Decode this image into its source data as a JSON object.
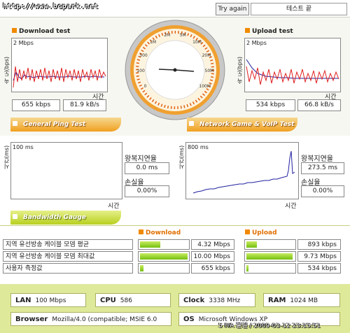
{
  "header": {
    "url": "http://www.bcpark.net",
    "retry_label": "Try again",
    "status_text": "테스트 끝"
  },
  "download": {
    "title": "Download test",
    "ylabel": "속 도(bps)",
    "scale": "2 Mbps",
    "xlabel": "시간",
    "kbps": "655 kbps",
    "kBs": "81.9 kB/s"
  },
  "upload": {
    "title": "Upload test",
    "ylabel": "속 도(bps)",
    "scale": "2 Mbps",
    "xlabel": "시간",
    "kbps": "534 kbps",
    "kBs": "66.8 kB/s"
  },
  "gauge": {
    "labels": [
      "0",
      "100",
      "500",
      "1M",
      "2M",
      "5M",
      "10M",
      "20M",
      "50M",
      "100M"
    ]
  },
  "ping": {
    "title": "General Ping Test",
    "ylabel": "시간(ms)",
    "scale": "100 ms",
    "xlabel": "시간",
    "rtt_label": "왕복지연율",
    "rtt_value": "0.0 ms",
    "loss_label": "손실율",
    "loss_value": "0.00%"
  },
  "game": {
    "title": "Network Game & VoIP Test",
    "ylabel": "시간(ms)",
    "scale": "800 ms",
    "xlabel": "시간",
    "rtt_label": "왕복지연율",
    "rtt_value": "273.5 ms",
    "loss_label": "손실율",
    "loss_value": "0.00%"
  },
  "bandwidth": {
    "title": "Bandwidth Gauge",
    "download_header": "Download",
    "upload_header": "Upload",
    "rows": [
      {
        "label": "지역 유선방송 케이블 모뎀 평균",
        "down": "4.32 Mbps",
        "down_fill": 0.43,
        "up": "893 kbps",
        "up_fill": 0.22
      },
      {
        "label": "지역 유선방송 케이블 모뎀 최대값",
        "down": "10.00 Mbps",
        "down_fill": 1.0,
        "up": "9.73 Mbps",
        "up_fill": 0.97
      },
      {
        "label": "사용자 측정값",
        "down": "655 kbps",
        "down_fill": 0.07,
        "up": "534 kbps",
        "up_fill": 0.05
      }
    ]
  },
  "system": {
    "lan_label": "LAN",
    "lan_value": "100 Mbps",
    "cpu_label": "CPU",
    "cpu_value": "586",
    "clock_label": "Clock",
    "clock_value": "3338 MHz",
    "ram_label": "RAM",
    "ram_value": "1024 MB",
    "browser_label": "Browser",
    "browser_value": "Mozilla/4.0 (compatible; MSIE 6.0",
    "os_label": "OS",
    "os_value": "Microsoft Windows XP"
  },
  "footer": {
    "timestamp": "5 ITA 물질 / 2009-03-12 23:15:51"
  },
  "colors": {
    "accent_orange": "#f08a00",
    "series_red": "#e02020",
    "series_blue": "#2020a0",
    "bar_green": "#74c010",
    "system_bg": "#dfe99a"
  }
}
